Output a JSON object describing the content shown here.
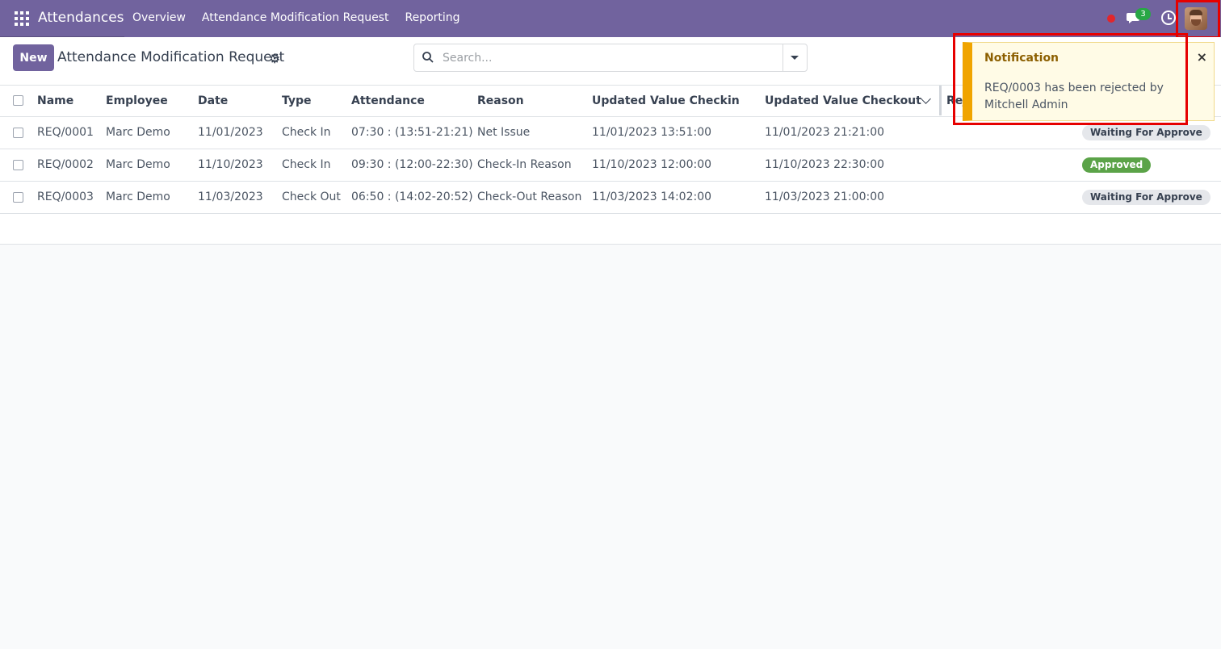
{
  "navbar": {
    "app_name": "Attendances",
    "menu": [
      "Overview",
      "Attendance Modification Request",
      "Reporting"
    ],
    "chat_count": "3"
  },
  "control_panel": {
    "new_label": "New",
    "title": "Attendance Modification Request",
    "search_placeholder": "Search..."
  },
  "table": {
    "headers": [
      "Name",
      "Employee",
      "Date",
      "Type",
      "Attendance",
      "Reason",
      "Updated Value Checkin",
      "Updated Value Checkout",
      "Rej"
    ],
    "rows": [
      {
        "name": "REQ/0001",
        "employee": "Marc Demo",
        "date": "11/01/2023",
        "type": "Check In",
        "attendance": "07:30 : (13:51-21:21)",
        "reason": "Net Issue",
        "checkin": "11/01/2023 13:51:00",
        "checkout": "11/01/2023 21:21:00",
        "status": "Waiting For Approve"
      },
      {
        "name": "REQ/0002",
        "employee": "Marc Demo",
        "date": "11/10/2023",
        "type": "Check In",
        "attendance": "09:30 : (12:00-22:30)",
        "reason": "Check-In Reason",
        "checkin": "11/10/2023 12:00:00",
        "checkout": "11/10/2023 22:30:00",
        "status": "Approved"
      },
      {
        "name": "REQ/0003",
        "employee": "Marc Demo",
        "date": "11/03/2023",
        "type": "Check Out",
        "attendance": "06:50 : (14:02-20:52)",
        "reason": "Check-Out Reason",
        "checkin": "11/03/2023 14:02:00",
        "checkout": "11/03/2023 21:00:00",
        "status": "Waiting For Approve"
      }
    ]
  },
  "notification": {
    "title": "Notification",
    "message": "REQ/0003 has been rejected by Mitchell Admin",
    "close": "×"
  },
  "colors": {
    "brand": "#71639e",
    "approved": "#5ba348",
    "warning": "#f0a400"
  }
}
